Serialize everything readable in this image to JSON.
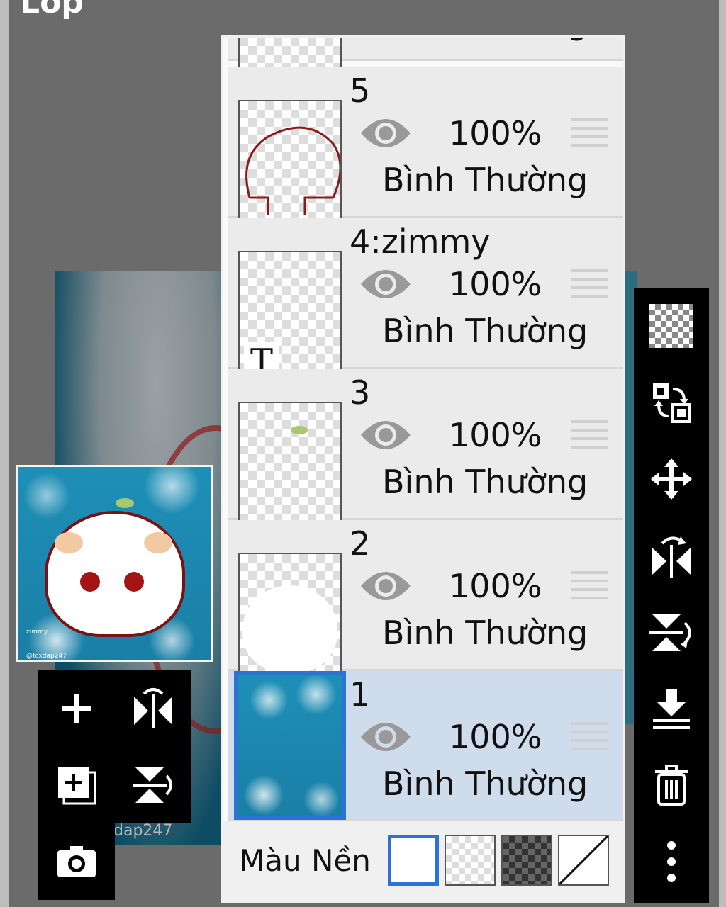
{
  "app": {
    "title": "Lớp"
  },
  "canvas": {
    "watermark": "dap247"
  },
  "preview": {
    "text1": "zimmy",
    "text2": "@tcxdap247"
  },
  "layers": [
    {
      "name": "5",
      "opacity": "100%",
      "blend": "Bình Thường",
      "selected": false,
      "content": "head-outline"
    },
    {
      "name": "4:zimmy",
      "opacity": "100%",
      "blend": "Bình Thường",
      "selected": false,
      "content": "text-layer"
    },
    {
      "name": "3",
      "opacity": "100%",
      "blend": "Bình Thường",
      "selected": false,
      "content": "sprout"
    },
    {
      "name": "2",
      "opacity": "100%",
      "blend": "Bình Thường",
      "selected": false,
      "content": "white-head"
    },
    {
      "name": "1",
      "opacity": "100%",
      "blend": "Bình Thường",
      "selected": true,
      "content": "blue-bokeh"
    }
  ],
  "partial_layer": {
    "blend": "Bình Thường"
  },
  "background": {
    "label": "Màu Nền",
    "options": [
      "white",
      "transparent",
      "dark-checker",
      "none"
    ],
    "selected": "white"
  },
  "thumb_text_glyph": "T",
  "icons": {
    "left_toolbar": [
      "add-layer-icon",
      "flip-horizontal-icon",
      "duplicate-layer-icon",
      "flip-vertical-icon",
      "camera-icon"
    ],
    "right_toolbar": [
      "transparency-checker-icon",
      "swap-layers-icon",
      "move-icon",
      "flip-horizontal-rotate-icon",
      "flip-vertical-rotate-icon",
      "merge-down-icon",
      "trash-icon",
      "more-vertical-icon"
    ]
  },
  "colors": {
    "selection": "#2d72d6",
    "selected_row": "#cfdcec",
    "toolbar": "#000000"
  }
}
